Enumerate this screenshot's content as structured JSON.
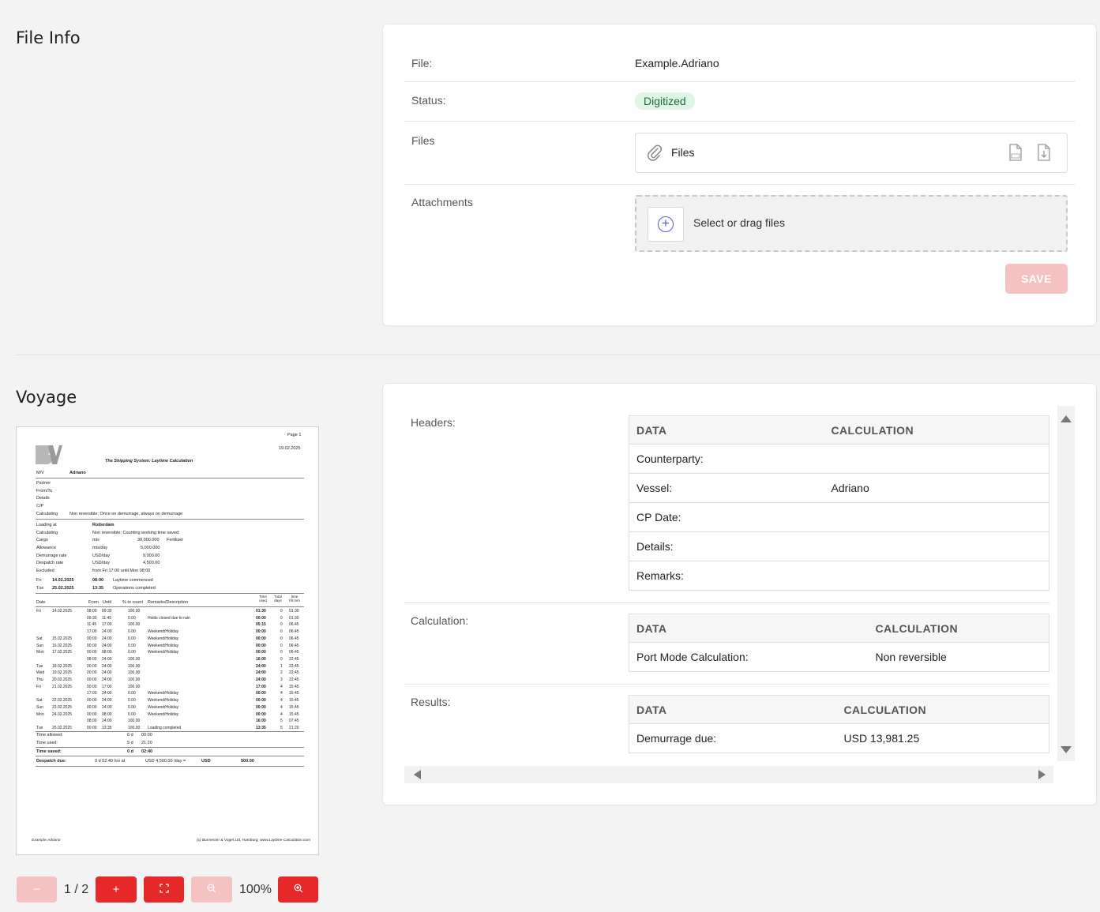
{
  "file_info": {
    "title": "File Info",
    "file_label": "File:",
    "file_value": "Example.Adriano",
    "status_label": "Status:",
    "status_value": "Digitized",
    "files_label": "Files",
    "files_box_text": "Files",
    "attachments_label": "Attachments",
    "drop_text": "Select or drag files",
    "save_label": "SAVE"
  },
  "voyage": {
    "title": "Voyage",
    "headers_label": "Headers:",
    "headers_table": {
      "columns": [
        "DATA",
        "CALCULATION"
      ],
      "rows": [
        [
          "Counterparty:",
          ""
        ],
        [
          "Vessel:",
          "Adriano"
        ],
        [
          "CP Date:",
          ""
        ],
        [
          "Details:",
          ""
        ],
        [
          "Remarks:",
          ""
        ]
      ]
    },
    "calculation_label": "Calculation:",
    "calculation_table": {
      "columns": [
        "DATA",
        "CALCULATION"
      ],
      "rows": [
        [
          "Port Mode Calculation:",
          "Non reversible"
        ]
      ]
    },
    "results_label": "Results:",
    "results_table": {
      "columns": [
        "DATA",
        "CALCULATION"
      ],
      "rows": [
        [
          "Demurrage due:",
          "USD 13,981.25"
        ]
      ]
    }
  },
  "viewer": {
    "minus_label": "−",
    "page_indicator": "1 / 2",
    "plus_label": "+",
    "zoom_level": "100%"
  },
  "document": {
    "page": "Page 1",
    "date": "19.02.2025",
    "heading": "The Shipping System: Laytime Calculation",
    "mv_label": "M/V",
    "mv_value": "Adriano",
    "partner": "Partner",
    "from_to": "From/To",
    "details": "Details",
    "cp": "C/P",
    "calculating": "Calculating",
    "calculating_value": "Non reversible; Once on demurrage, always on demurrage",
    "loading_at": "Loading at",
    "port": "Rotterdam",
    "calculating2": "Calculating",
    "calc2_value": "Non reversible; Counting working time saved",
    "cargo": "Cargo",
    "cargo_unit": "mts",
    "cargo_value": "30,000.000",
    "cargo_name": "Fertilizer",
    "allowance": "Allowance",
    "allowance_unit": "mts/day",
    "allowance_value": "5,000.000",
    "dem_rate": "Demurrage rate",
    "dem_unit": "USD/day",
    "dem_value": "9,000.00",
    "desp_rate": "Despatch rate",
    "desp_unit": "USD/day",
    "desp_value": "4,500.00",
    "excluded": "Excluded",
    "excluded_value": "from Fri 17:00 until Mon 08:00",
    "fri": "Fri",
    "fri_date": "14.02.2025",
    "fri_time": "08:00",
    "fri_text": "Laytime commenced",
    "tue": "Tue",
    "tue_date": "25.02.2025",
    "tue_time": "13:35",
    "tue_text": "Operations completed",
    "col_time_used": "Time used",
    "col_total_days": "Total days",
    "col_time": "time hh:mm",
    "col_date": "Date",
    "col_from": "From",
    "col_until": "Until",
    "col_pct": "% to count",
    "col_remarks": "Remarks/Description",
    "log_rows": [
      [
        "Fri",
        "14.02.2025",
        "08:00",
        "09:30",
        "100.00",
        "",
        "01:30",
        "0",
        "01:30"
      ],
      [
        "",
        "",
        "09:30",
        "11:45",
        "0.00",
        "Holds closed due to rain",
        "00:00",
        "0",
        "01:30"
      ],
      [
        "",
        "",
        "11:45",
        "17:00",
        "100.00",
        "",
        "05:15",
        "0",
        "06:45"
      ],
      [
        "",
        "",
        "17:00",
        "24:00",
        "0.00",
        "Weekend/Holiday",
        "00:00",
        "0",
        "06:45"
      ],
      [
        "Sat",
        "15.02.2025",
        "00:00",
        "24:00",
        "0.00",
        "Weekend/Holiday",
        "00:00",
        "0",
        "06:45"
      ],
      [
        "Sun",
        "16.02.2025",
        "00:00",
        "24:00",
        "0.00",
        "Weekend/Holiday",
        "00:00",
        "0",
        "06:45"
      ],
      [
        "Mon",
        "17.02.2025",
        "00:00",
        "08:00",
        "0.00",
        "Weekend/Holiday",
        "00:00",
        "0",
        "06:45"
      ],
      [
        "",
        "",
        "08:00",
        "24:00",
        "100.00",
        "",
        "16:00",
        "0",
        "22:45"
      ],
      [
        "Tue",
        "18.02.2025",
        "00:00",
        "24:00",
        "100.00",
        "",
        "24:00",
        "1",
        "22:45"
      ],
      [
        "Wed",
        "19.02.2025",
        "00:00",
        "24:00",
        "100.00",
        "",
        "24:00",
        "2",
        "22:45"
      ],
      [
        "Thu",
        "20.02.2025",
        "00:00",
        "24:00",
        "100.00",
        "",
        "24:00",
        "3",
        "22:45"
      ],
      [
        "Fri",
        "21.02.2025",
        "00:00",
        "17:00",
        "100.00",
        "",
        "17:00",
        "4",
        "15:45"
      ],
      [
        "",
        "",
        "17:00",
        "24:00",
        "0.00",
        "Weekend/Holiday",
        "00:00",
        "4",
        "15:45"
      ],
      [
        "Sat",
        "22.02.2025",
        "00:00",
        "24:00",
        "0.00",
        "Weekend/Holiday",
        "00:00",
        "4",
        "15:45"
      ],
      [
        "Sun",
        "23.02.2025",
        "00:00",
        "24:00",
        "0.00",
        "Weekend/Holiday",
        "00:00",
        "4",
        "15:45"
      ],
      [
        "Mon",
        "24.02.2025",
        "00:00",
        "08:00",
        "0.00",
        "Weekend/Holiday",
        "00:00",
        "4",
        "15:45"
      ],
      [
        "",
        "",
        "08:00",
        "24:00",
        "100.00",
        "",
        "16:00",
        "5",
        "07:45"
      ],
      [
        "Tue",
        "25.02.2025",
        "00:00",
        "13:35",
        "100.00",
        "Loading completed",
        "13:35",
        "5",
        "21:20"
      ]
    ],
    "time_allowed": "Time allowed:",
    "time_allowed_d": "6 d",
    "time_allowed_t": "00:00",
    "time_used": "Time used:",
    "time_used_d": "5 d",
    "time_used_t": "21:20",
    "time_saved": "Time saved:",
    "time_saved_d": "0 d",
    "time_saved_t": "02:40",
    "despatch_due": "Despatch due:",
    "despatch_calc": "0 d 02:40 hrs at",
    "despatch_rate": "USD 4,500.00 /day =",
    "despatch_cur": "USD",
    "despatch_amount": "500.00",
    "footer_left": "Example.Adriano",
    "footer_right": "(c) Burmester & Vogel Ltd, Hamburg, www.Laytime-Calculation.com"
  },
  "colors": {
    "accent_red": "#e62828",
    "accent_red_disabled": "#f5c2c2",
    "status_green_bg": "#dff5e6"
  }
}
